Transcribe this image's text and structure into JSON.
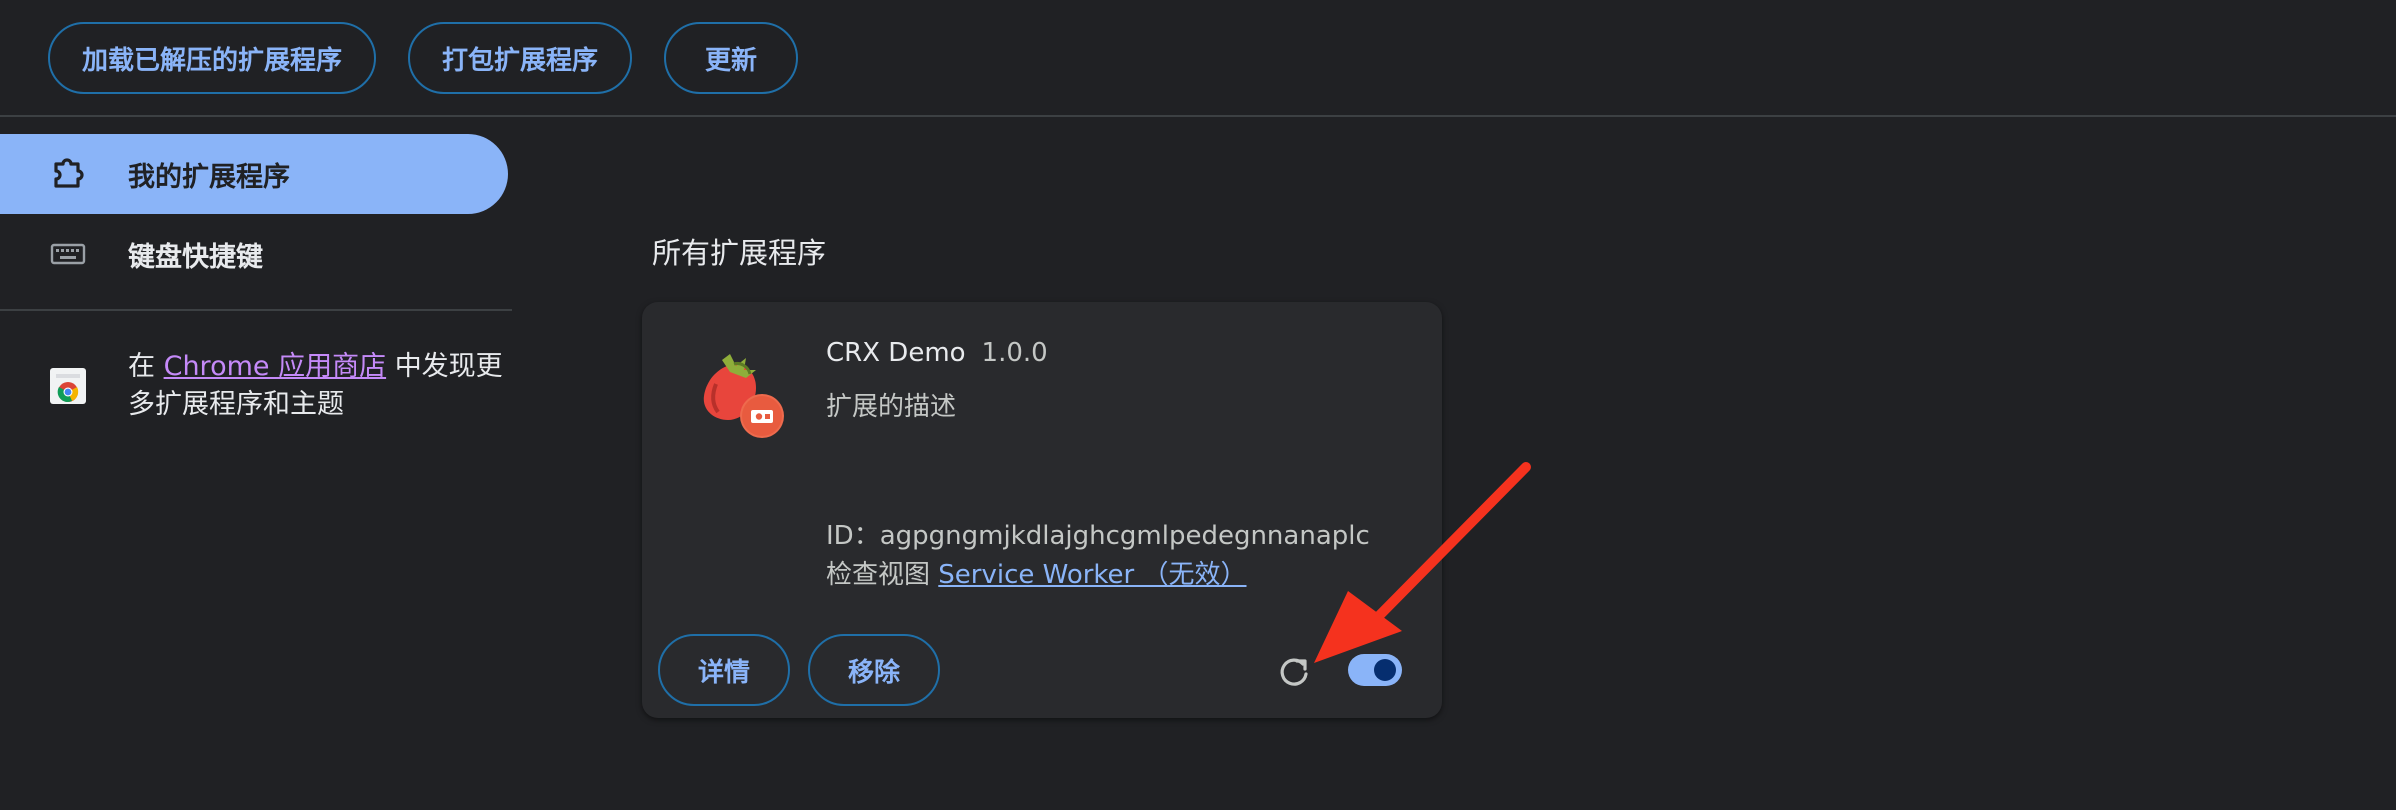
{
  "toolbar": {
    "load_unpacked_label": "加载已解压的扩展程序",
    "pack_label": "打包扩展程序",
    "update_label": "更新"
  },
  "sidebar": {
    "items": [
      {
        "label": "我的扩展程序",
        "icon": "puzzle-icon",
        "active": true
      },
      {
        "label": "键盘快捷键",
        "icon": "keyboard-icon",
        "active": false
      }
    ],
    "store": {
      "prefix": "在",
      "link": "Chrome 应用商店",
      "suffix": "中发现更多扩展程序和主题"
    }
  },
  "main": {
    "section_title": "所有扩展程序",
    "extension": {
      "name": "CRX Demo",
      "version": "1.0.0",
      "description": "扩展的描述",
      "id_label": "ID：",
      "id": "agpgngmjkdlajghcgmlpedegnnanaplc",
      "views_label": "检查视图",
      "views_link": "Service Worker （无效）",
      "details_label": "详情",
      "remove_label": "移除",
      "enabled": true
    }
  },
  "colors": {
    "background": "#202124",
    "accent": "#8ab4f8",
    "link_purple": "#c58af9",
    "annotation_arrow": "#f5321e"
  }
}
